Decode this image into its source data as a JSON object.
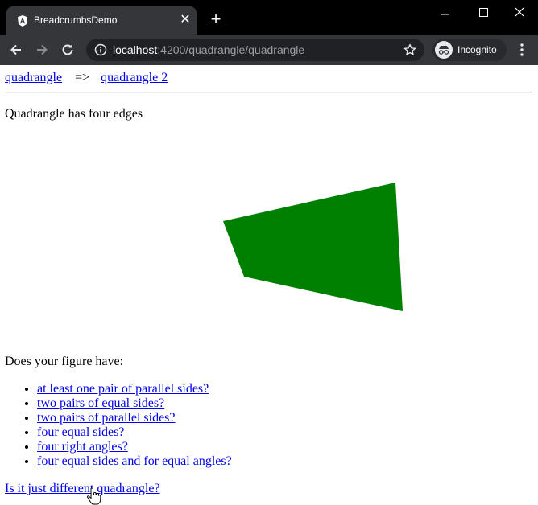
{
  "browser": {
    "tab_title": "BreadcrumbsDemo",
    "url_host": "localhost",
    "url_path": ":4200/quadrangle/quadrangle",
    "profile_label": "Incognito"
  },
  "breadcrumbs": {
    "items": [
      "quadrangle",
      "quadrangle 2"
    ],
    "separator": "=>"
  },
  "description": "Quadrangle has four edges",
  "figure": {
    "fill_color": "#008000"
  },
  "question": "Does your figure have:",
  "options": [
    "at least one pair of parallel sides?",
    "two pairs of equal sides?",
    "two pairs of parallel sides?",
    "four equal sides?",
    "four right angles?",
    "four equal sides and for equal angles?"
  ],
  "more_link": "Is it just different quadrangle?"
}
